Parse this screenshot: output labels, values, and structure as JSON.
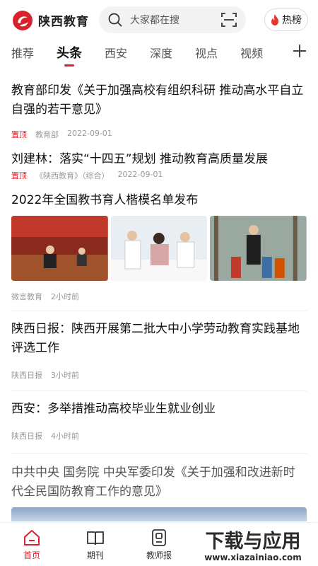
{
  "colors": {
    "accent": "#d9232c",
    "text": "#111111",
    "meta": "#999999"
  },
  "header": {
    "logo_text": "陕西教育",
    "search_placeholder": "大家都在搜",
    "hot_label": "热榜"
  },
  "tabs": [
    {
      "label": "推荐"
    },
    {
      "label": "头条",
      "active": true
    },
    {
      "label": "西安"
    },
    {
      "label": "深度"
    },
    {
      "label": "视点"
    },
    {
      "label": "视频"
    }
  ],
  "feed": [
    {
      "title": "教育部印发《关于加强高校有组织科研 推动高水平自立自强的若干意见》",
      "badge": "置顶",
      "source": "教育部",
      "date": "2022-09-01"
    },
    {
      "title": "刘建林：落实“十四五”规划  推动教育高质量发展",
      "badge": "置顶",
      "source": "《陕西教育》（综合）",
      "date": "2022-09-01"
    },
    {
      "title": "2022年全国教书育人楷模名单发布",
      "source": "微言教育",
      "time": "2小时前"
    },
    {
      "title": "陕西日报：陕西开展第二批大中小学劳动教育实践基地评选工作",
      "source": "陕西日报",
      "time": "3小时前"
    },
    {
      "title": "西安：多举措推动高校毕业生就业创业",
      "source": "陕西日报",
      "time": "4小时前"
    },
    {
      "title": "中共中央 国务院 中央军委印发《关于加强和改进新时代全民国防教育工作的意见》"
    }
  ],
  "bottom_nav": [
    {
      "label": "首页",
      "icon": "home-icon",
      "active": true
    },
    {
      "label": "期刊",
      "icon": "book-icon"
    },
    {
      "label": "教师报",
      "icon": "newspaper-icon"
    }
  ],
  "watermark": {
    "text": "下载与应用",
    "url": "www.xiazainiao.com"
  }
}
